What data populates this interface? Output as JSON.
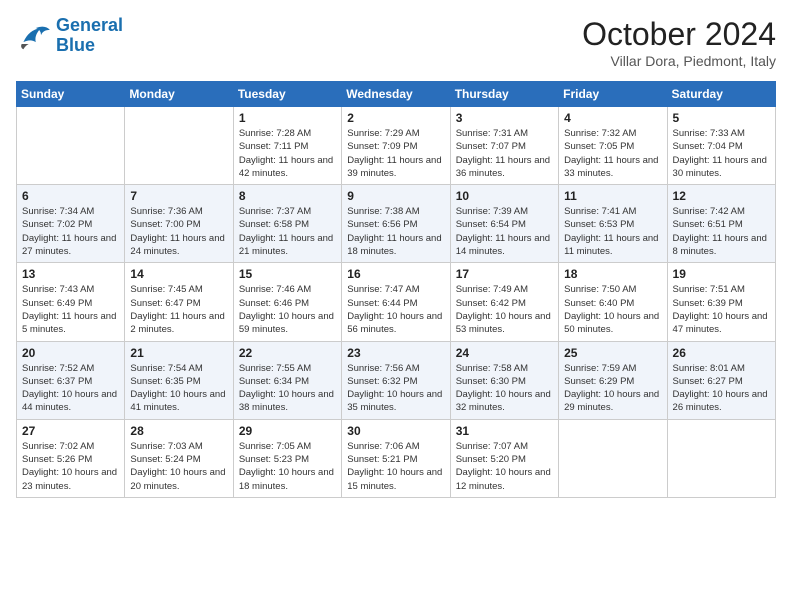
{
  "header": {
    "logo_line1": "General",
    "logo_line2": "Blue",
    "month": "October 2024",
    "location": "Villar Dora, Piedmont, Italy"
  },
  "weekdays": [
    "Sunday",
    "Monday",
    "Tuesday",
    "Wednesday",
    "Thursday",
    "Friday",
    "Saturday"
  ],
  "weeks": [
    [
      {
        "day": "",
        "info": ""
      },
      {
        "day": "",
        "info": ""
      },
      {
        "day": "1",
        "info": "Sunrise: 7:28 AM\nSunset: 7:11 PM\nDaylight: 11 hours and 42 minutes."
      },
      {
        "day": "2",
        "info": "Sunrise: 7:29 AM\nSunset: 7:09 PM\nDaylight: 11 hours and 39 minutes."
      },
      {
        "day": "3",
        "info": "Sunrise: 7:31 AM\nSunset: 7:07 PM\nDaylight: 11 hours and 36 minutes."
      },
      {
        "day": "4",
        "info": "Sunrise: 7:32 AM\nSunset: 7:05 PM\nDaylight: 11 hours and 33 minutes."
      },
      {
        "day": "5",
        "info": "Sunrise: 7:33 AM\nSunset: 7:04 PM\nDaylight: 11 hours and 30 minutes."
      }
    ],
    [
      {
        "day": "6",
        "info": "Sunrise: 7:34 AM\nSunset: 7:02 PM\nDaylight: 11 hours and 27 minutes."
      },
      {
        "day": "7",
        "info": "Sunrise: 7:36 AM\nSunset: 7:00 PM\nDaylight: 11 hours and 24 minutes."
      },
      {
        "day": "8",
        "info": "Sunrise: 7:37 AM\nSunset: 6:58 PM\nDaylight: 11 hours and 21 minutes."
      },
      {
        "day": "9",
        "info": "Sunrise: 7:38 AM\nSunset: 6:56 PM\nDaylight: 11 hours and 18 minutes."
      },
      {
        "day": "10",
        "info": "Sunrise: 7:39 AM\nSunset: 6:54 PM\nDaylight: 11 hours and 14 minutes."
      },
      {
        "day": "11",
        "info": "Sunrise: 7:41 AM\nSunset: 6:53 PM\nDaylight: 11 hours and 11 minutes."
      },
      {
        "day": "12",
        "info": "Sunrise: 7:42 AM\nSunset: 6:51 PM\nDaylight: 11 hours and 8 minutes."
      }
    ],
    [
      {
        "day": "13",
        "info": "Sunrise: 7:43 AM\nSunset: 6:49 PM\nDaylight: 11 hours and 5 minutes."
      },
      {
        "day": "14",
        "info": "Sunrise: 7:45 AM\nSunset: 6:47 PM\nDaylight: 11 hours and 2 minutes."
      },
      {
        "day": "15",
        "info": "Sunrise: 7:46 AM\nSunset: 6:46 PM\nDaylight: 10 hours and 59 minutes."
      },
      {
        "day": "16",
        "info": "Sunrise: 7:47 AM\nSunset: 6:44 PM\nDaylight: 10 hours and 56 minutes."
      },
      {
        "day": "17",
        "info": "Sunrise: 7:49 AM\nSunset: 6:42 PM\nDaylight: 10 hours and 53 minutes."
      },
      {
        "day": "18",
        "info": "Sunrise: 7:50 AM\nSunset: 6:40 PM\nDaylight: 10 hours and 50 minutes."
      },
      {
        "day": "19",
        "info": "Sunrise: 7:51 AM\nSunset: 6:39 PM\nDaylight: 10 hours and 47 minutes."
      }
    ],
    [
      {
        "day": "20",
        "info": "Sunrise: 7:52 AM\nSunset: 6:37 PM\nDaylight: 10 hours and 44 minutes."
      },
      {
        "day": "21",
        "info": "Sunrise: 7:54 AM\nSunset: 6:35 PM\nDaylight: 10 hours and 41 minutes."
      },
      {
        "day": "22",
        "info": "Sunrise: 7:55 AM\nSunset: 6:34 PM\nDaylight: 10 hours and 38 minutes."
      },
      {
        "day": "23",
        "info": "Sunrise: 7:56 AM\nSunset: 6:32 PM\nDaylight: 10 hours and 35 minutes."
      },
      {
        "day": "24",
        "info": "Sunrise: 7:58 AM\nSunset: 6:30 PM\nDaylight: 10 hours and 32 minutes."
      },
      {
        "day": "25",
        "info": "Sunrise: 7:59 AM\nSunset: 6:29 PM\nDaylight: 10 hours and 29 minutes."
      },
      {
        "day": "26",
        "info": "Sunrise: 8:01 AM\nSunset: 6:27 PM\nDaylight: 10 hours and 26 minutes."
      }
    ],
    [
      {
        "day": "27",
        "info": "Sunrise: 7:02 AM\nSunset: 5:26 PM\nDaylight: 10 hours and 23 minutes."
      },
      {
        "day": "28",
        "info": "Sunrise: 7:03 AM\nSunset: 5:24 PM\nDaylight: 10 hours and 20 minutes."
      },
      {
        "day": "29",
        "info": "Sunrise: 7:05 AM\nSunset: 5:23 PM\nDaylight: 10 hours and 18 minutes."
      },
      {
        "day": "30",
        "info": "Sunrise: 7:06 AM\nSunset: 5:21 PM\nDaylight: 10 hours and 15 minutes."
      },
      {
        "day": "31",
        "info": "Sunrise: 7:07 AM\nSunset: 5:20 PM\nDaylight: 10 hours and 12 minutes."
      },
      {
        "day": "",
        "info": ""
      },
      {
        "day": "",
        "info": ""
      }
    ]
  ]
}
